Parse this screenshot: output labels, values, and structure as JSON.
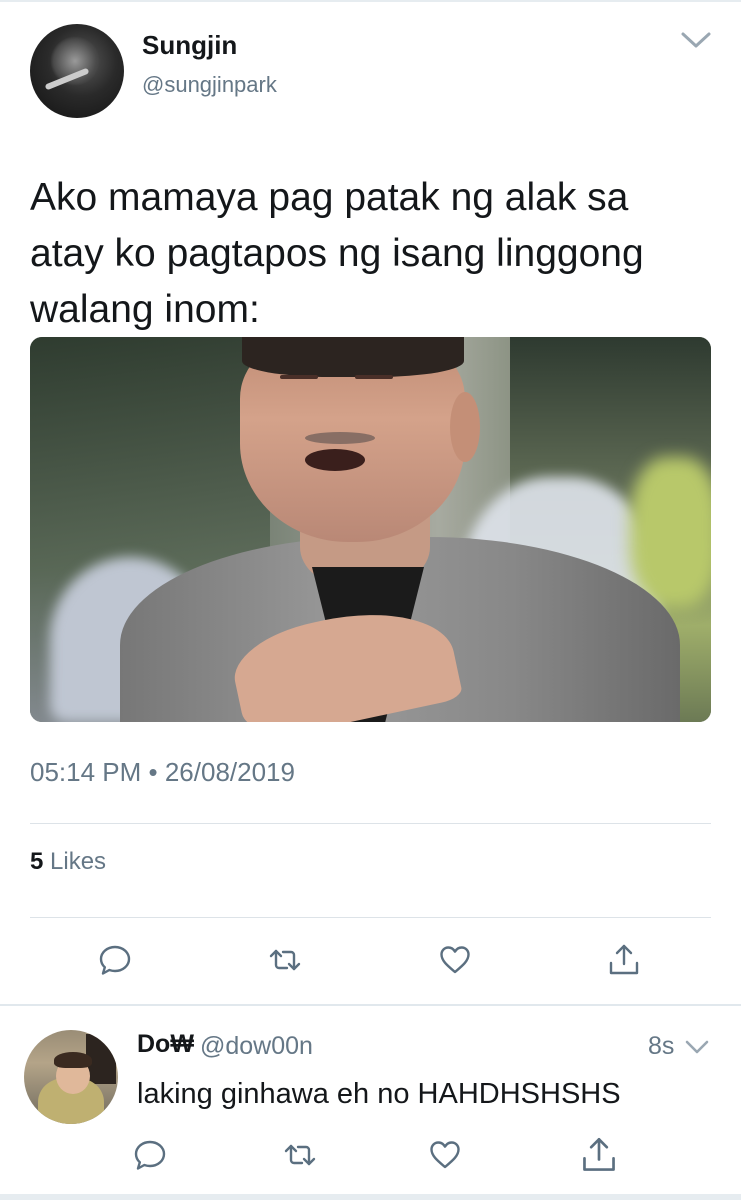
{
  "colors": {
    "text": "#14171a",
    "secondary": "#657786",
    "divider": "#dde3e8"
  },
  "tweet": {
    "author_name": "Sungjin",
    "author_handle": "@sungjinpark",
    "text": "Ako mamaya pag patak ng alak sa\natay ko pagtapos ng isang linggong\nwalang inom:",
    "timestamp": "05:14 PM • 26/08/2019",
    "likes_count": "5",
    "likes_label": "Likes",
    "actions": [
      "reply-icon",
      "retweet-icon",
      "like-icon",
      "share-icon"
    ]
  },
  "reply": {
    "author_name": "Do₩",
    "author_handle": "@dow00n",
    "time": "8s",
    "text": "laking ginhawa eh no HAHDHSHSHS",
    "actions": [
      "reply-icon",
      "retweet-icon",
      "like-icon",
      "share-icon"
    ]
  }
}
